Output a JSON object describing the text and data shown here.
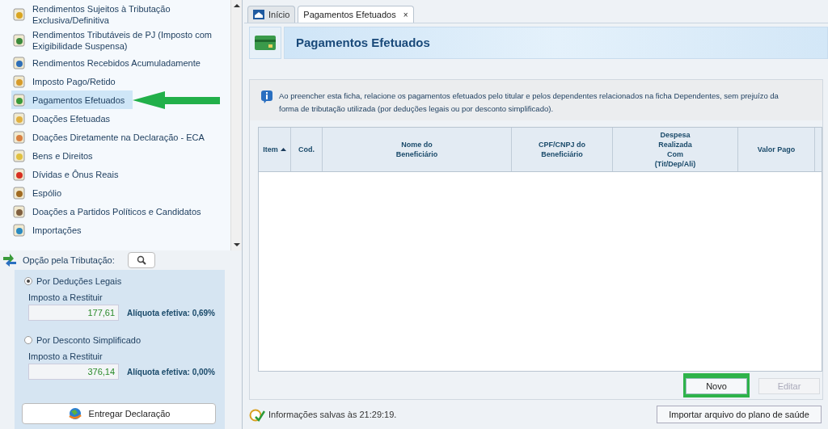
{
  "sidebar": {
    "items": [
      {
        "label": "Rendimentos Sujeitos à Tributação Exclusiva/Definitiva",
        "selected": false,
        "annotated": false
      },
      {
        "label": "Rendimentos Tributáveis de PJ (Imposto com Exigibilidade Suspensa)",
        "selected": false,
        "annotated": false
      },
      {
        "label": "Rendimentos Recebidos Acumuladamente",
        "selected": false,
        "annotated": false
      },
      {
        "label": "Imposto Pago/Retido",
        "selected": false,
        "annotated": false
      },
      {
        "label": "Pagamentos Efetuados",
        "selected": true,
        "annotated": true
      },
      {
        "label": "Doações Efetuadas",
        "selected": false,
        "annotated": false
      },
      {
        "label": "Doações Diretamente na Declaração - ECA",
        "selected": false,
        "annotated": false
      },
      {
        "label": "Bens e Direitos",
        "selected": false,
        "annotated": false
      },
      {
        "label": "Dívidas e Ônus Reais",
        "selected": false,
        "annotated": false
      },
      {
        "label": "Espólio",
        "selected": false,
        "annotated": false
      },
      {
        "label": "Doações a Partidos Políticos e Candidatos",
        "selected": false,
        "annotated": false
      },
      {
        "label": "Importações",
        "selected": false,
        "annotated": false
      }
    ]
  },
  "taxation": {
    "title": "Opção pela Tributação:",
    "options": [
      {
        "label": "Por Deduções Legais",
        "selected": true,
        "field_label": "Imposto a Restituir",
        "value": "177,61",
        "rate": "Alíquota efetiva: 0,69%"
      },
      {
        "label": "Por Desconto Simplificado",
        "selected": false,
        "field_label": "Imposto a Restituir",
        "value": "376,14",
        "rate": "Alíquota efetiva: 0,00%"
      }
    ],
    "submit_button": "Entregar Declaração"
  },
  "tabs": [
    {
      "label": "Início",
      "selected": false,
      "closable": false
    },
    {
      "label": "Pagamentos Efetuados",
      "selected": true,
      "closable": true
    }
  ],
  "close_glyph": "×",
  "page_title": "Pagamentos Efetuados",
  "info": "Ao preencher esta ficha, relacione os pagamentos efetuados pelo titular e pelos dependentes relacionados na ficha Dependentes, sem prejuízo da\nforma de tributação utilizada (por deduções legais ou por desconto simplificado).",
  "table": {
    "columns": [
      {
        "label": "Item",
        "sorted": true
      },
      {
        "label": "Cod.",
        "sorted": false
      },
      {
        "label": "Nome do\nBeneficiário",
        "sorted": false
      },
      {
        "label": "CPF/CNPJ do\nBeneficiário",
        "sorted": false
      },
      {
        "label": "Despesa\nRealizada\nCom\n(Tit/Dep/Ali)",
        "sorted": false
      },
      {
        "label": "Valor Pago",
        "sorted": false
      }
    ]
  },
  "buttons": [
    {
      "label": "Novo",
      "disabled": false,
      "highlighted": true
    },
    {
      "label": "Editar",
      "disabled": true,
      "highlighted": false
    }
  ],
  "status_bar": {
    "text": "Informações salvas às 21:29:19.",
    "import_button": "Importar arquivo do plano de saúde"
  }
}
